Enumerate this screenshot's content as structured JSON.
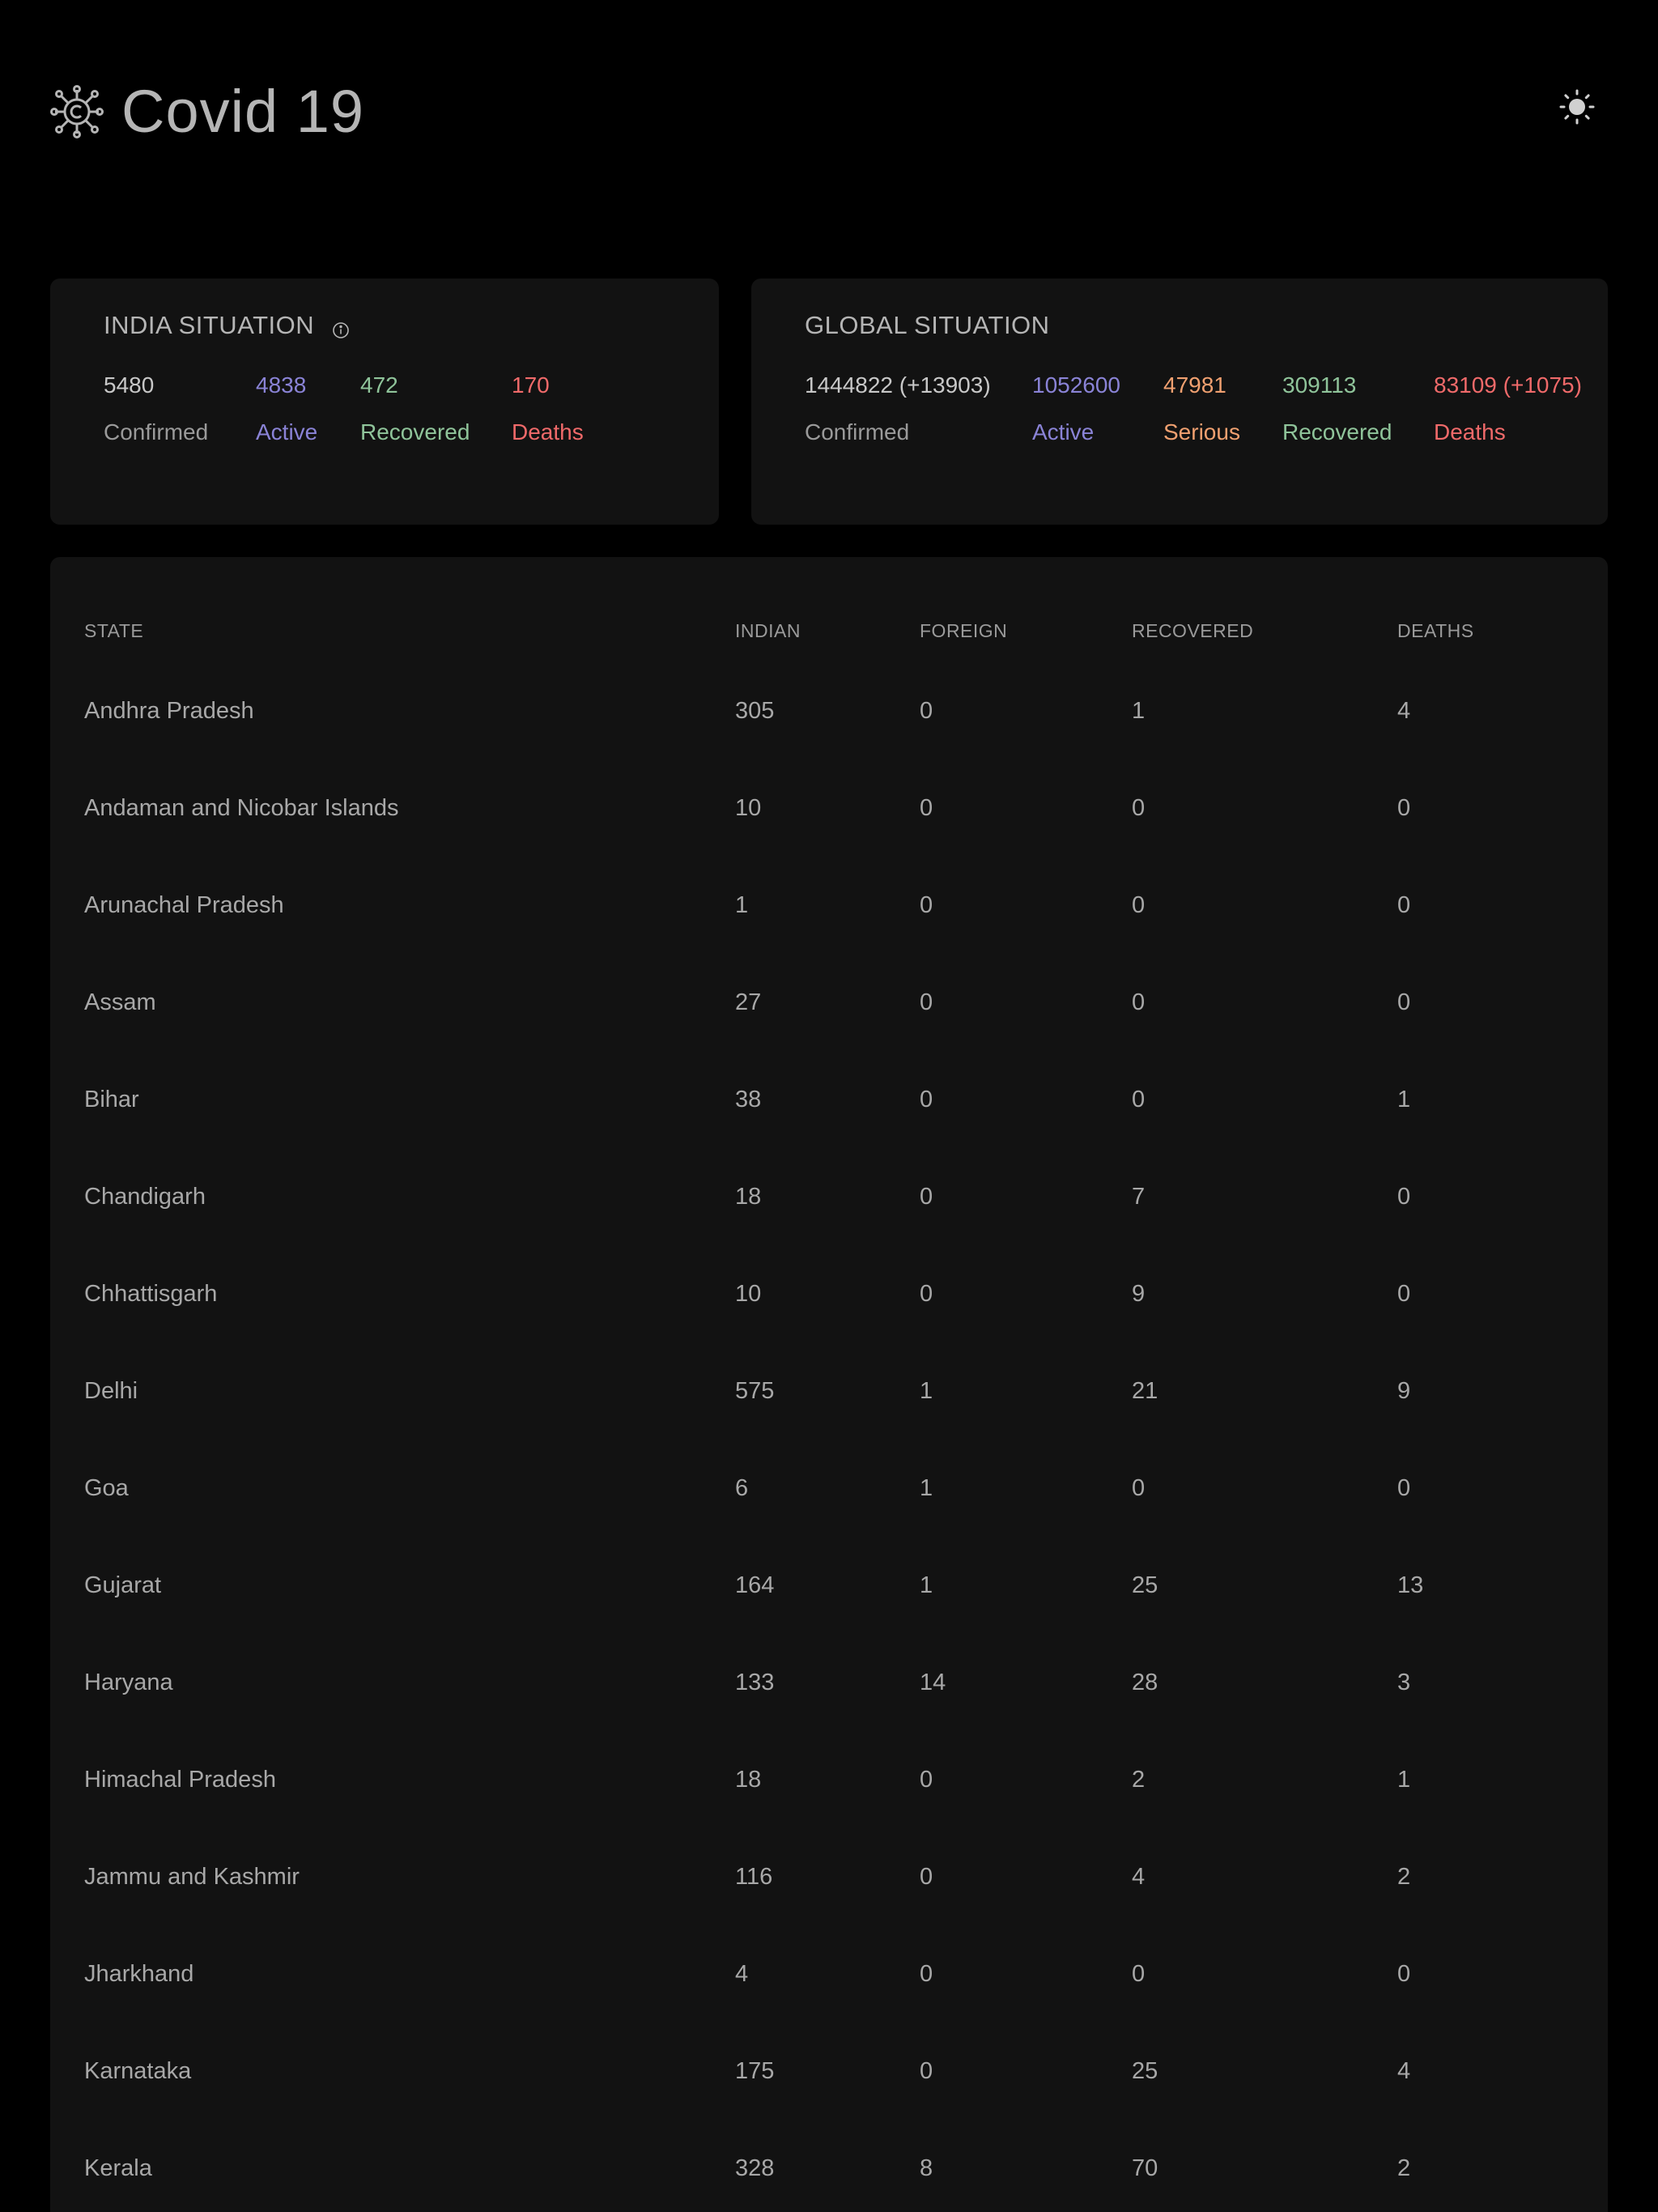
{
  "header": {
    "title": "Covid 19",
    "logo_icon": "virus-icon",
    "theme_toggle_icon": "sun-icon"
  },
  "india": {
    "title": "INDIA SITUATION",
    "info_icon": "info-icon",
    "stats": [
      {
        "value": "5480",
        "label": "Confirmed",
        "color": "#c8c8c8"
      },
      {
        "value": "4838",
        "label": "Active",
        "color": "#8a83d6"
      },
      {
        "value": "472",
        "label": "Recovered",
        "color": "#8fc49a"
      },
      {
        "value": "170",
        "label": "Deaths",
        "color": "#f06a6a"
      }
    ]
  },
  "global": {
    "title": "GLOBAL SITUATION",
    "stats": [
      {
        "value": "1444822 (+13903)",
        "label": "Confirmed",
        "color": "#c8c8c8"
      },
      {
        "value": "1052600",
        "label": "Active",
        "color": "#8a83d6"
      },
      {
        "value": "47981",
        "label": "Serious",
        "color": "#f0a070"
      },
      {
        "value": "309113",
        "label": "Recovered",
        "color": "#8fc49a"
      },
      {
        "value": "83109 (+1075)",
        "label": "Deaths",
        "color": "#f06a6a"
      }
    ]
  },
  "table": {
    "headers": {
      "state": "STATE",
      "indian": "INDIAN",
      "foreign": "FOREIGN",
      "recovered": "RECOVERED",
      "deaths": "DEATHS"
    },
    "rows": [
      {
        "state": "Andhra Pradesh",
        "indian": "305",
        "foreign": "0",
        "recovered": "1",
        "deaths": "4"
      },
      {
        "state": "Andaman and Nicobar Islands",
        "indian": "10",
        "foreign": "0",
        "recovered": "0",
        "deaths": "0"
      },
      {
        "state": "Arunachal Pradesh",
        "indian": "1",
        "foreign": "0",
        "recovered": "0",
        "deaths": "0"
      },
      {
        "state": "Assam",
        "indian": "27",
        "foreign": "0",
        "recovered": "0",
        "deaths": "0"
      },
      {
        "state": "Bihar",
        "indian": "38",
        "foreign": "0",
        "recovered": "0",
        "deaths": "1"
      },
      {
        "state": "Chandigarh",
        "indian": "18",
        "foreign": "0",
        "recovered": "7",
        "deaths": "0"
      },
      {
        "state": "Chhattisgarh",
        "indian": "10",
        "foreign": "0",
        "recovered": "9",
        "deaths": "0"
      },
      {
        "state": "Delhi",
        "indian": "575",
        "foreign": "1",
        "recovered": "21",
        "deaths": "9"
      },
      {
        "state": "Goa",
        "indian": "6",
        "foreign": "1",
        "recovered": "0",
        "deaths": "0"
      },
      {
        "state": "Gujarat",
        "indian": "164",
        "foreign": "1",
        "recovered": "25",
        "deaths": "13"
      },
      {
        "state": "Haryana",
        "indian": "133",
        "foreign": "14",
        "recovered": "28",
        "deaths": "3"
      },
      {
        "state": "Himachal Pradesh",
        "indian": "18",
        "foreign": "0",
        "recovered": "2",
        "deaths": "1"
      },
      {
        "state": "Jammu and Kashmir",
        "indian": "116",
        "foreign": "0",
        "recovered": "4",
        "deaths": "2"
      },
      {
        "state": "Jharkhand",
        "indian": "4",
        "foreign": "0",
        "recovered": "0",
        "deaths": "0"
      },
      {
        "state": "Karnataka",
        "indian": "175",
        "foreign": "0",
        "recovered": "25",
        "deaths": "4"
      },
      {
        "state": "Kerala",
        "indian": "328",
        "foreign": "8",
        "recovered": "70",
        "deaths": "2"
      }
    ]
  }
}
